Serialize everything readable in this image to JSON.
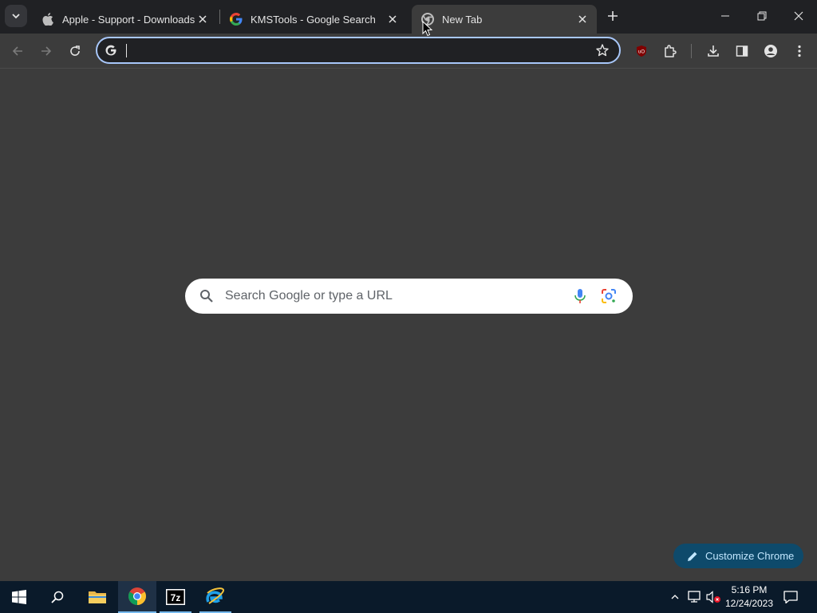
{
  "tabs": [
    {
      "title": "Apple - Support - Downloads",
      "favicon": "apple-icon"
    },
    {
      "title": "KMSTools - Google Search",
      "favicon": "google-g-icon"
    },
    {
      "title": "New Tab",
      "favicon": "chrome-icon",
      "active": true
    }
  ],
  "omnibox": {
    "value": "",
    "placeholder": ""
  },
  "ntp": {
    "search_placeholder": "Search Google or type a URL",
    "customize_label": "Customize Chrome"
  },
  "taskbar": {
    "pinned": [
      "windows-start",
      "search",
      "file-explorer",
      "chrome",
      "7-zip",
      "internet-explorer"
    ],
    "time": "5:16 PM",
    "date": "12/24/2023"
  },
  "colors": {
    "tabstrip_bg": "#202124",
    "toolbar_bg": "#3c3c3c",
    "omnibox_focus": "#a8c7fa",
    "customize_bg": "#0e4a6b",
    "taskbar_bg": "#0a1a2a"
  }
}
